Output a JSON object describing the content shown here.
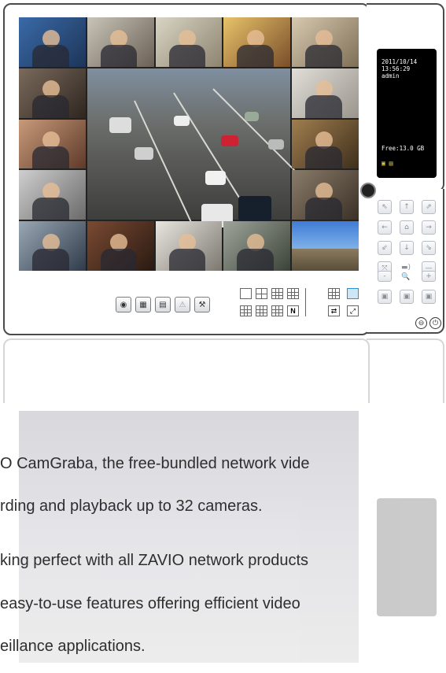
{
  "info_panel": {
    "date": "2011/10/14",
    "time": "13:56:29",
    "user": "admin",
    "free_space": "Free:13.0 GB",
    "status_icons": "▣ ▤"
  },
  "toolbar": {
    "record_icon": "◉",
    "snapshot_icon": "▦",
    "playback_icon": "▤",
    "alarm_icon": "⚠",
    "settings_icon": "⚒",
    "n_label": "N",
    "cycle_icon": "⇄",
    "fullscreen_icon": "⤢"
  },
  "ptz": {
    "up_left": "⇖",
    "up": "↑",
    "up_right": "⇗",
    "left": "←",
    "home": "⌂",
    "right": "→",
    "down_left": "⇙",
    "down": "↓",
    "down_right": "⇘",
    "zoom_in": "⤧",
    "audio": "▬)",
    "zoom_out": "—",
    "minus": "-",
    "search": "🔍",
    "plus": "+",
    "preset_a": "▣",
    "preset_b": "▣",
    "preset_c": "▣"
  },
  "window_controls": {
    "minimize": "⊖",
    "power": "⏻"
  },
  "description": {
    "line1": "O CamGraba, the free-bundled network vide",
    "line2": "rding and playback up to 32 cameras.",
    "line3": "king perfect with all ZAVIO network products",
    "line4": "easy-to-use features offering efficient video",
    "line5": "eillance applications."
  },
  "colors": {
    "frame": "#4b4b4b",
    "info_bg": "#000000",
    "text": "#2e2e2e"
  }
}
